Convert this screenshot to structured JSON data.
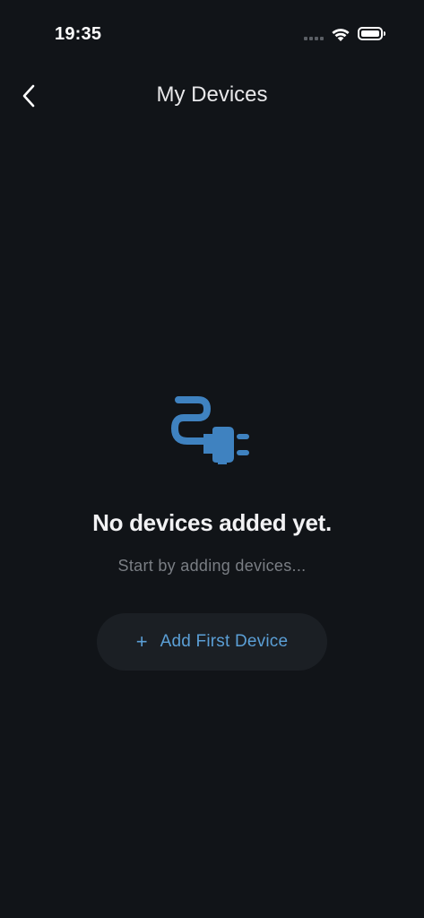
{
  "status_bar": {
    "time": "19:35"
  },
  "nav": {
    "title": "My Devices",
    "back_icon": "chevron-left-icon"
  },
  "empty_state": {
    "icon": "plug-icon",
    "title": "No devices added yet.",
    "subtitle": "Start by adding devices..."
  },
  "add_button": {
    "plus": "+",
    "label": "Add First Device"
  },
  "colors": {
    "background": "#111418",
    "accent": "#5b9fd6",
    "icon": "#3f82c0",
    "button_bg": "#1b1f24",
    "subtitle": "#7a7e84"
  }
}
